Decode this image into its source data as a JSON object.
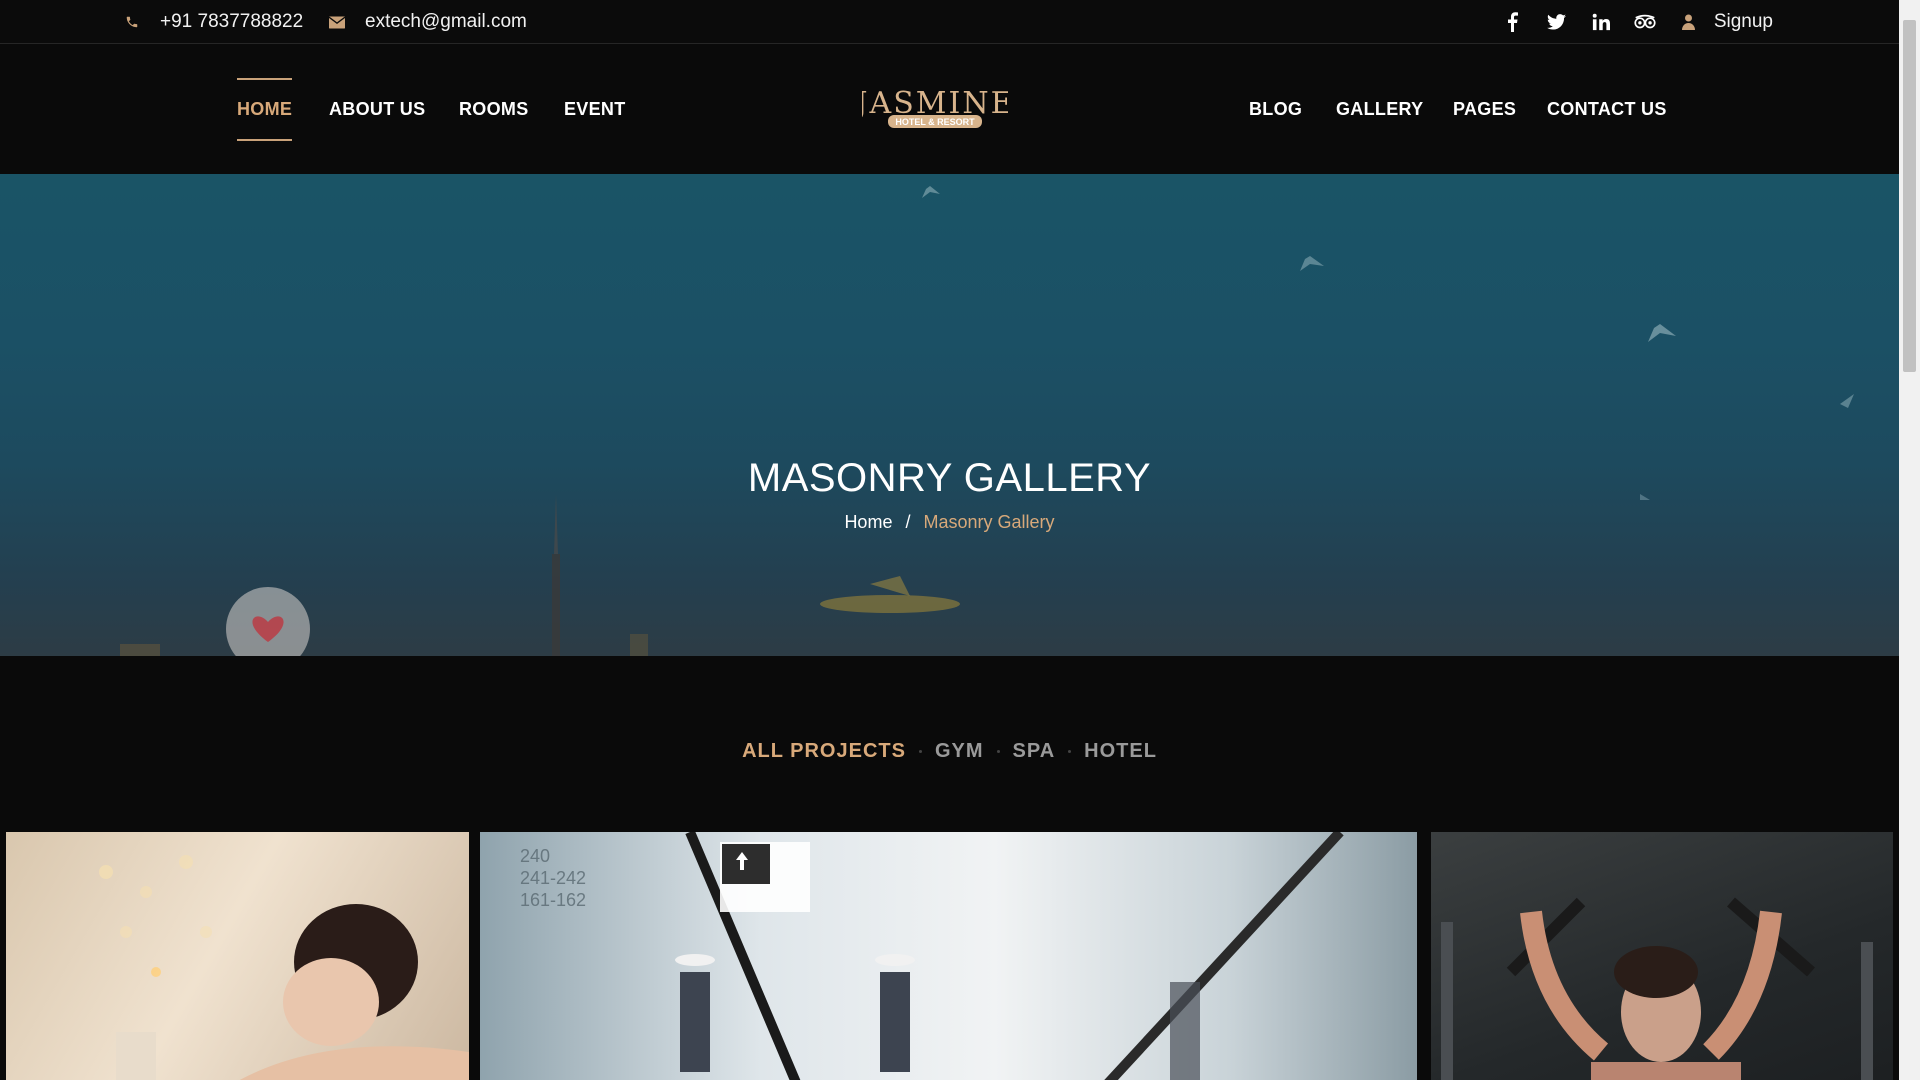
{
  "topbar": {
    "phone": "+91 7837788822",
    "email": "extech@gmail.com",
    "phone_icon": "phone-icon",
    "email_icon": "envelope-icon",
    "social_icons": [
      "facebook-icon",
      "twitter-icon",
      "linkedin-icon",
      "tripadvisor-icon",
      "user-icon"
    ],
    "signup_label": "Signup"
  },
  "nav": {
    "left_items": [
      {
        "label": "HOME",
        "active": true
      },
      {
        "label": "ABOUT US"
      },
      {
        "label": "ROOMS"
      },
      {
        "label": "EVENT"
      }
    ],
    "right_items": [
      {
        "label": "BLOG"
      },
      {
        "label": "GALLERY"
      },
      {
        "label": "PAGES"
      },
      {
        "label": "CONTACT US"
      }
    ],
    "logo": {
      "main": "JASMINE",
      "sub": "HOTEL & RESORT"
    }
  },
  "hero": {
    "title": "MASONRY GALLERY",
    "breadcrumb": {
      "home": "Home",
      "separator": "/",
      "current": "Masonry Gallery"
    }
  },
  "filters": {
    "items": [
      "ALL PROJECTS",
      "GYM",
      "SPA",
      "HOTEL"
    ],
    "active": "ALL PROJECTS"
  },
  "gallery": {
    "items": [
      "spa-image",
      "airport-escalator-image",
      "gym-image"
    ]
  },
  "colors": {
    "accent": "#d8a97a",
    "background": "#0a0a0a",
    "text": "#ffffff",
    "muted": "#9a9a9a"
  }
}
